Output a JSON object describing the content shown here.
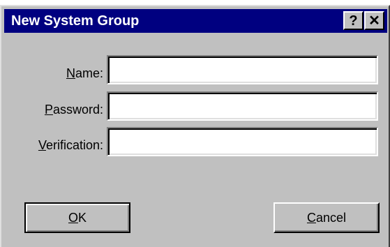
{
  "window": {
    "title": "New System Group",
    "help_glyph": "?",
    "close_glyph": "✕",
    "colors": {
      "titlebar": "#000080",
      "face": "#c0c0c0"
    }
  },
  "fields": [
    {
      "mnemonic": "N",
      "label_rest": "ame:",
      "value": ""
    },
    {
      "mnemonic": "P",
      "label_rest": "assword:",
      "value": ""
    },
    {
      "mnemonic": "V",
      "label_rest": "erification:",
      "value": ""
    }
  ],
  "buttons": {
    "ok": {
      "mnemonic": "O",
      "rest": "K"
    },
    "cancel": {
      "mnemonic": "C",
      "rest": "ancel"
    }
  }
}
